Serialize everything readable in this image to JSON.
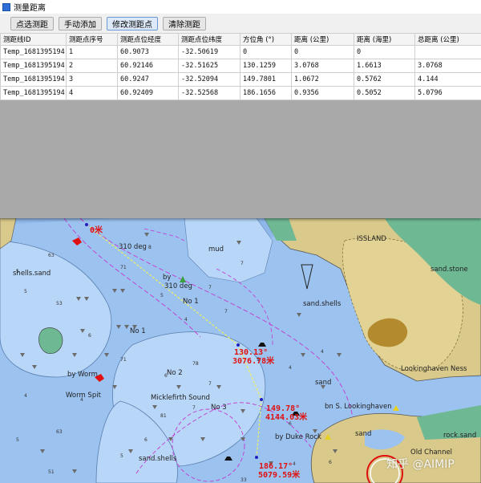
{
  "dialog": {
    "title": "测量距离",
    "buttons": [
      "点选测距",
      "手动添加",
      "修改测距点",
      "清除测距"
    ],
    "active_button": "修改测距点",
    "columns": [
      "测距线ID",
      "测距点序号",
      "测距点位经度",
      "测距点位纬度",
      "方位角 (°)",
      "距离 (公里)",
      "距离 (海里)",
      "总距离 (公里)"
    ],
    "rows": [
      [
        "Temp_1681395194",
        "1",
        "60.9073",
        "-32.50619",
        "0",
        "0",
        "0",
        ""
      ],
      [
        "Temp_1681395194",
        "2",
        "60.92146",
        "-32.51625",
        "130.1259",
        "3.0768",
        "1.6613",
        "3.0768"
      ],
      [
        "Temp_1681395194",
        "3",
        "60.9247",
        "-32.52094",
        "149.7801",
        "1.0672",
        "0.5762",
        "4.144"
      ],
      [
        "Temp_1681395194",
        "4",
        "60.92409",
        "-32.52568",
        "186.1656",
        "0.9356",
        "0.5052",
        "5.0796"
      ]
    ]
  },
  "map": {
    "route_labels": {
      "p1": "0米",
      "p2_bearing": "130.13°",
      "p2_dist": "3076.78米",
      "p3_bearing": "149.78°",
      "p3_dist": "4144.03米",
      "p4_bearing": "186.17°",
      "p4_dist": "5079.59米"
    },
    "labels": {
      "deg310": "310 deg",
      "by310": "by",
      "deg310b": "310 deg",
      "mud": "mud",
      "isl": "ISSLAND",
      "shells_sand": "shells.sand",
      "no1a": "No 1",
      "no1b": "No 1",
      "no2": "No 2",
      "no3": "No 3",
      "sand_shells_r": "sand.shells",
      "sand_stone": "sand.stone",
      "by_worm": "by Worm",
      "worm_spit": "Worm Spit",
      "micklefirth": "Micklefirth Sound",
      "looking_ness": "Lookinghaven Ness",
      "bn_looking": "bn S. Lookinghaven",
      "by_duke": "by Duke Rock",
      "sand1": "sand",
      "sand2": "sand",
      "rock_sand": "rock.sand",
      "sand_shells_b": "sand.shells",
      "old_channel": "Old Channel"
    },
    "colors": {
      "deep": "#8fb8ea",
      "shallow": "#b8d6f7",
      "land": "#d9c98a",
      "green_shore": "#6fb894",
      "route": "#f0f060",
      "bearing_text": "#e01010",
      "magenta": "#c23bd0"
    }
  },
  "watermark": "知乎 @AIMIP"
}
